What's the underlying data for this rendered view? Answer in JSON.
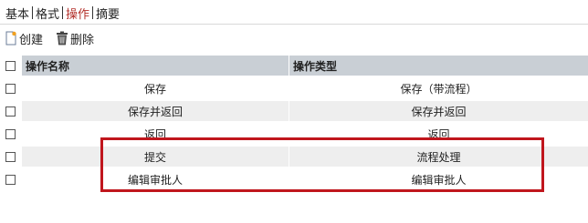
{
  "tabs": [
    {
      "label": "基本",
      "active": false
    },
    {
      "label": "格式",
      "active": false
    },
    {
      "label": "操作",
      "active": true
    },
    {
      "label": "摘要",
      "active": false
    }
  ],
  "toolbar": {
    "create_label": "创建",
    "delete_label": "删除"
  },
  "table": {
    "headers": [
      "操作名称",
      "操作类型"
    ],
    "rows": [
      {
        "name": "保存",
        "type": "保存（带流程）"
      },
      {
        "name": "保存并返回",
        "type": "保存并返回"
      },
      {
        "name": "返回",
        "type": "返回"
      },
      {
        "name": "提交",
        "type": "流程处理"
      },
      {
        "name": "编辑审批人",
        "type": "编辑审批人"
      }
    ]
  },
  "colors": {
    "active_tab": "#b3302a",
    "header_bg": "#c9cfd5",
    "alt_row_bg": "#eeeeee",
    "highlight_border": "#c0161d"
  }
}
